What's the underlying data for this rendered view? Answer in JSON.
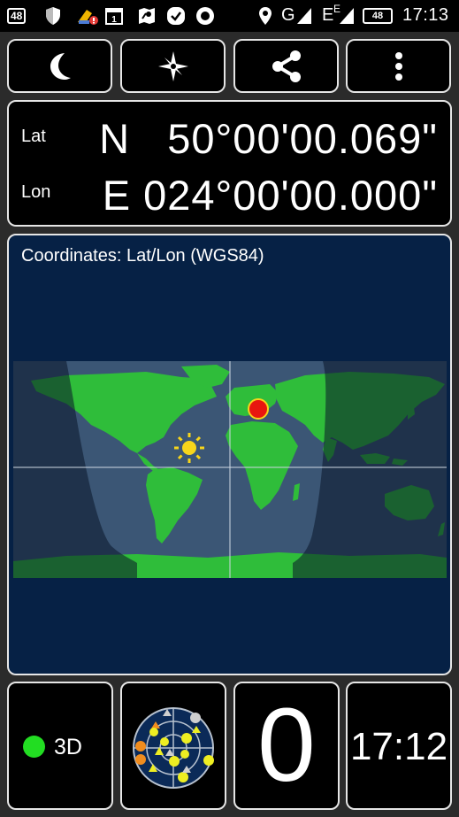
{
  "status_bar": {
    "notif_count": "48",
    "sim_badge": "1",
    "network_g": "G",
    "network_e": "E",
    "network_e_sup": "E",
    "battery": "48",
    "time": "17:13"
  },
  "toolbar": {
    "night_mode_icon": "moon-icon",
    "compass_icon": "compass-rose-icon",
    "share_icon": "share-icon",
    "menu_icon": "more-vert-icon"
  },
  "position": {
    "lat_label": "Lat",
    "lat_value": "N   50°00'00.069\"",
    "lon_label": "Lon",
    "lon_value": "E 024°00'00.000\""
  },
  "map": {
    "title": "Coordinates: Lat/Lon (WGS84)",
    "colors": {
      "background": "#062145",
      "land": "#2fbd3a",
      "night": "#1c2e44",
      "marker": "#e8160f",
      "sun": "#f7d51b"
    }
  },
  "status": {
    "fix_label": "3D",
    "fix_color": "#22dd22",
    "satellites_used": "0",
    "clock": "17:12"
  }
}
